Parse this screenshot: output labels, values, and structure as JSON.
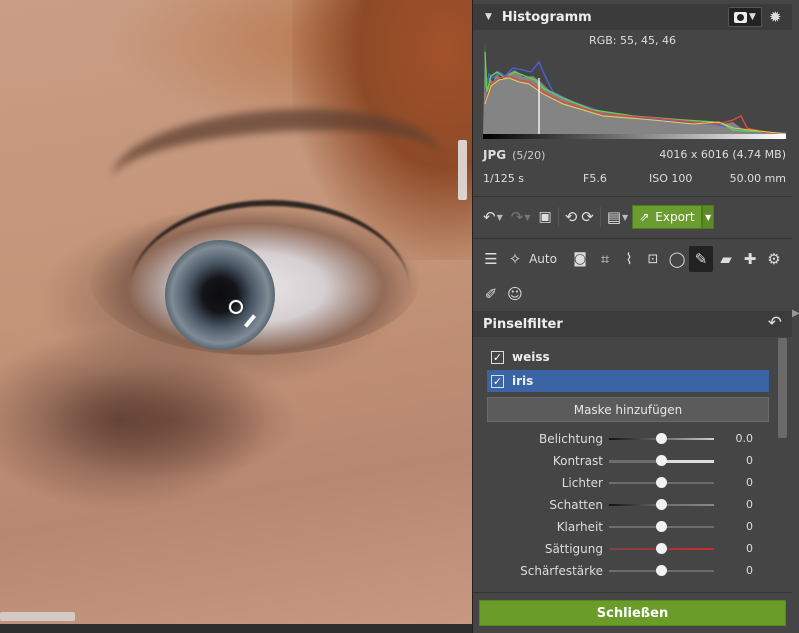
{
  "histogram": {
    "title": "Histogramm",
    "rgb_readout": "RGB: 55, 45, 46"
  },
  "image_info": {
    "format": "JPG",
    "index": "(5/20)",
    "dimensions": "4016 x 6016 (4.74 MB)",
    "shutter": "1/125 s",
    "aperture": "F5.6",
    "iso": "ISO 100",
    "focal_length": "50.00 mm"
  },
  "toolbar": {
    "export_label": "Export"
  },
  "tools": {
    "auto_label": "Auto"
  },
  "brush_filter": {
    "title": "Pinselfilter",
    "masks": [
      {
        "label": "weiss",
        "checked": true,
        "selected": false
      },
      {
        "label": "iris",
        "checked": true,
        "selected": true
      }
    ],
    "add_mask_label": "Maske hinzufügen",
    "sliders": [
      {
        "label": "Belichtung",
        "value": "0.0",
        "track": "gradient-dark"
      },
      {
        "label": "Kontrast",
        "value": "0",
        "track": "contrast"
      },
      {
        "label": "Lichter",
        "value": "0",
        "track": "plain"
      },
      {
        "label": "Schatten",
        "value": "0",
        "track": "dark"
      },
      {
        "label": "Klarheit",
        "value": "0",
        "track": "plain"
      },
      {
        "label": "Sättigung",
        "value": "0",
        "track": "saturation"
      },
      {
        "label": "Schärfestärke",
        "value": "0",
        "track": "plain"
      }
    ]
  },
  "close_label": "Schließen",
  "colors": {
    "accent_green": "#6a9c2a",
    "selection_blue": "#3a64a4",
    "panel_bg": "#454545"
  }
}
